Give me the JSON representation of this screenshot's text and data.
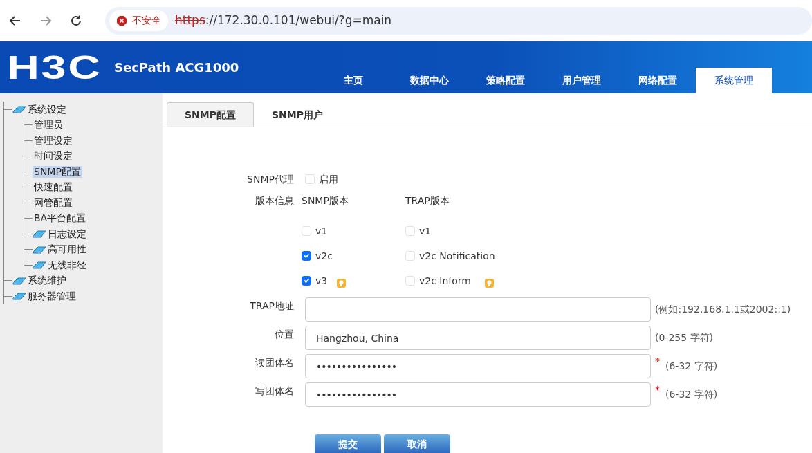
{
  "browser": {
    "security": "不安全",
    "url_scheme": "https",
    "url_rest": "://172.30.0.101/webui/?g=main"
  },
  "header": {
    "logo": "H3C",
    "product": "SecPath ACG1000",
    "nav": [
      {
        "label": "主页",
        "selected": false
      },
      {
        "label": "数据中心",
        "selected": false
      },
      {
        "label": "策略配置",
        "selected": false
      },
      {
        "label": "用户管理",
        "selected": false
      },
      {
        "label": "网络配置",
        "selected": false
      },
      {
        "label": "系统管理",
        "selected": true
      }
    ]
  },
  "sidebar": {
    "items": [
      {
        "label": "系统设定",
        "kind": "folder",
        "selected": false,
        "children": [
          {
            "label": "管理员",
            "kind": "page",
            "selected": false
          },
          {
            "label": "管理设定",
            "kind": "page",
            "selected": false
          },
          {
            "label": "时间设定",
            "kind": "page",
            "selected": false
          },
          {
            "label": "SNMP配置",
            "kind": "page",
            "selected": true
          },
          {
            "label": "快速配置",
            "kind": "page",
            "selected": false
          },
          {
            "label": "网管配置",
            "kind": "page",
            "selected": false
          },
          {
            "label": "BA平台配置",
            "kind": "page",
            "selected": false
          },
          {
            "label": "日志设定",
            "kind": "folder",
            "selected": false
          },
          {
            "label": "高可用性",
            "kind": "folder",
            "selected": false
          },
          {
            "label": "无线非经",
            "kind": "folder",
            "selected": false
          }
        ]
      },
      {
        "label": "系统维护",
        "kind": "folder",
        "selected": false
      },
      {
        "label": "服务器管理",
        "kind": "folder",
        "selected": false
      }
    ]
  },
  "tabs": [
    {
      "label": "SNMP配置",
      "selected": true
    },
    {
      "label": "SNMP用户",
      "selected": false
    }
  ],
  "form": {
    "agent_label": "SNMP代理",
    "agent_option": {
      "label": "启用",
      "checked": false
    },
    "version_label": "版本信息",
    "snmp_heading": "SNMP版本",
    "trap_heading": "TRAP版本",
    "snmp_versions": [
      {
        "label": "v1",
        "checked": false,
        "hint": false
      },
      {
        "label": "v2c",
        "checked": true,
        "hint": false
      },
      {
        "label": "v3",
        "checked": true,
        "hint": true
      }
    ],
    "trap_versions": [
      {
        "label": "v1",
        "checked": false,
        "hint": false
      },
      {
        "label": "v2c Notification",
        "checked": false,
        "hint": false
      },
      {
        "label": "v2c Inform",
        "checked": false,
        "hint": true
      }
    ],
    "fields": [
      {
        "label": "TRAP地址",
        "kind": "text",
        "note": "(例如:192.168.1.1或2002::1)"
      },
      {
        "label": "位置",
        "kind": "text",
        "value": "Hangzhou, China",
        "note": "(0-255 字符)"
      },
      {
        "label": "读团体名",
        "kind": "password",
        "value": "••••••••••••••••",
        "required_mark": "*",
        "note": "(6-32 字符)"
      },
      {
        "label": "写团体名",
        "kind": "password",
        "value": "••••••••••••••••",
        "required_mark": "*",
        "note": "(6-32 字符)"
      }
    ],
    "buttons": [
      "提交",
      "取消"
    ]
  }
}
